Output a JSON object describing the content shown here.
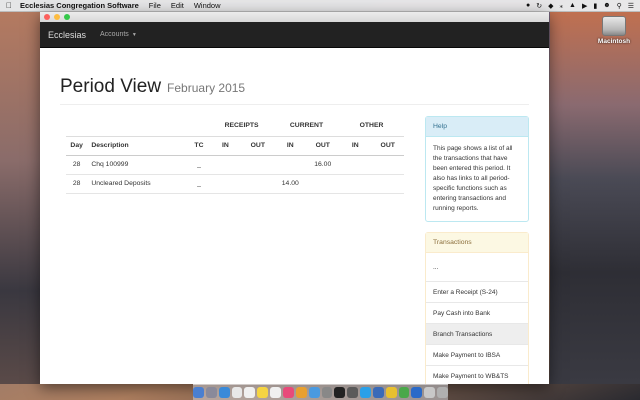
{
  "menubar": {
    "app_name": "Ecclesias Congregation Software",
    "menus": [
      "File",
      "Edit",
      "Window"
    ]
  },
  "desktop": {
    "drive_label": "Macintosh"
  },
  "navbar": {
    "brand": "Ecclesias",
    "accounts_label": "Accounts"
  },
  "page": {
    "title": "Period View",
    "subtitle": "February 2015"
  },
  "table": {
    "groups": [
      "RECEIPTS",
      "CURRENT",
      "OTHER"
    ],
    "headers": [
      "Day",
      "Description",
      "TC",
      "IN",
      "OUT",
      "IN",
      "OUT",
      "IN",
      "OUT"
    ],
    "rows": [
      {
        "day": "28",
        "description": "Chq 100999",
        "tc": "_",
        "r_in": "",
        "r_out": "",
        "c_in": "",
        "c_out": "16.00",
        "o_in": "",
        "o_out": ""
      },
      {
        "day": "28",
        "description": "Uncleared Deposits",
        "tc": "_",
        "r_in": "",
        "r_out": "",
        "c_in": "14.00",
        "c_out": "",
        "o_in": "",
        "o_out": ""
      }
    ]
  },
  "help": {
    "title": "Help",
    "body": "This page shows a list of all the transactions that have been entered this period. It also has links to all period-specific functions such as entering transactions and running reports."
  },
  "transactions": {
    "title": "Transactions",
    "items": [
      "...",
      "Enter a Receipt (S-24)",
      "Pay Cash into Bank",
      "Branch Transactions",
      "Make Payment to IBSA",
      "Make Payment to WB&TS"
    ]
  },
  "colors": {
    "navbar": "#222222",
    "help_heading": "#d9edf7",
    "transactions_heading": "#fcf8e3"
  }
}
